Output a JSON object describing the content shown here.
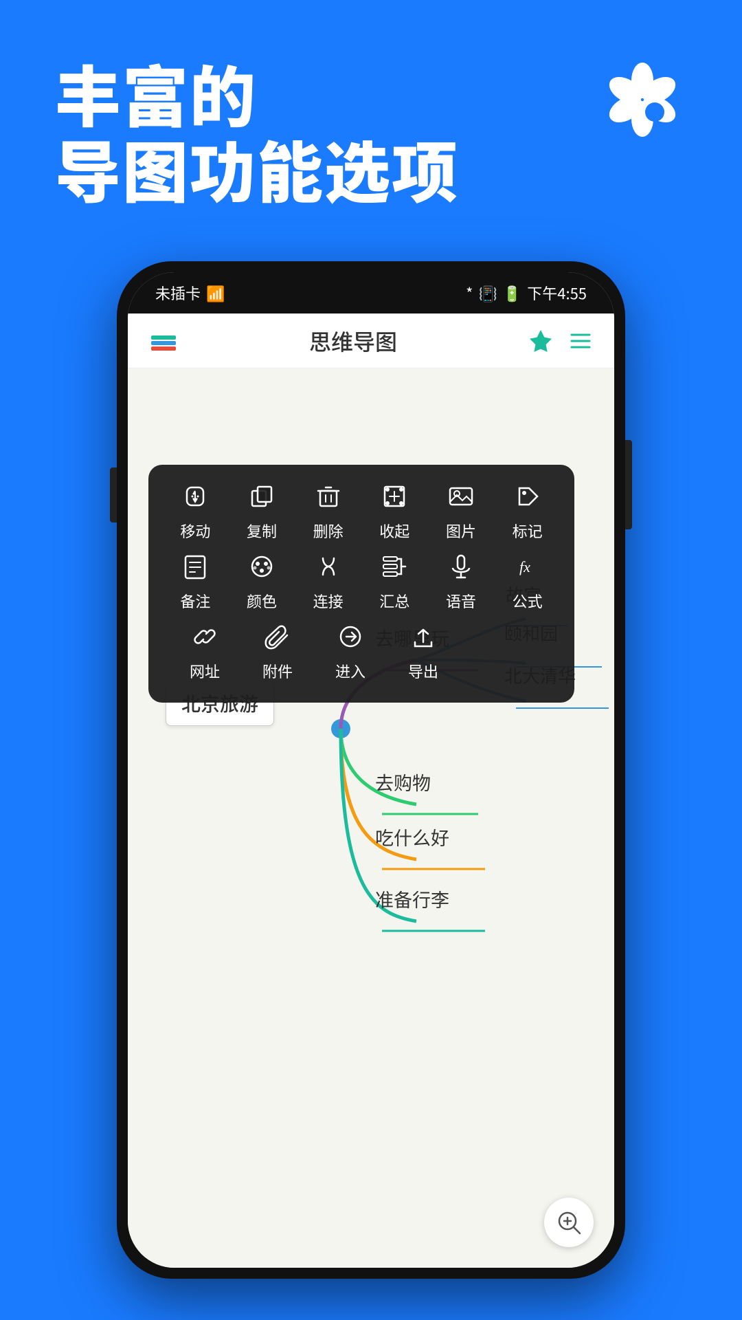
{
  "app": {
    "background_color": "#1a7bff",
    "headline_line1": "丰富的",
    "headline_line2": "导图功能选项"
  },
  "status_bar": {
    "carrier": "未插卡",
    "wifi": "WiFi",
    "time": "下午4:55",
    "battery": "电池"
  },
  "app_header": {
    "title": "思维导图"
  },
  "context_menu": {
    "rows": [
      [
        {
          "icon": "✋",
          "label": "移动",
          "unicode": "☚"
        },
        {
          "icon": "⬜",
          "label": "复制"
        },
        {
          "icon": "🗑",
          "label": "删除"
        },
        {
          "icon": "⊞",
          "label": "收起"
        },
        {
          "icon": "🖼",
          "label": "图片"
        },
        {
          "icon": "🏷",
          "label": "标记"
        }
      ],
      [
        {
          "icon": "📋",
          "label": "备注"
        },
        {
          "icon": "🎨",
          "label": "颜色"
        },
        {
          "icon": "∫",
          "label": "连接"
        },
        {
          "icon": "◈",
          "label": "汇总"
        },
        {
          "icon": "🎤",
          "label": "语音"
        },
        {
          "icon": "fx",
          "label": "公式"
        }
      ],
      [
        {
          "icon": "🔗",
          "label": "网址"
        },
        {
          "icon": "📎",
          "label": "附件"
        },
        {
          "icon": "→",
          "label": "进入"
        },
        {
          "icon": "↑",
          "label": "导出"
        }
      ]
    ]
  },
  "mindmap": {
    "central_node": "北京旅游",
    "nodes": [
      {
        "id": "where",
        "text": "去哪里玩",
        "color": "#9b59b6"
      },
      {
        "id": "palace",
        "text": "故宫",
        "color": "#3498db"
      },
      {
        "id": "yuanmingyuan",
        "text": "颐和园",
        "color": "#3498db"
      },
      {
        "id": "university",
        "text": "北大清华",
        "color": "#3498db"
      },
      {
        "id": "shopping",
        "text": "去购物",
        "color": "#2ecc71"
      },
      {
        "id": "food",
        "text": "吃什么好",
        "color": "#f39c12"
      },
      {
        "id": "luggage",
        "text": "准备行李",
        "color": "#1abc9c"
      }
    ]
  },
  "zoom_button": {
    "icon": "⊕",
    "label": "zoom-in"
  }
}
